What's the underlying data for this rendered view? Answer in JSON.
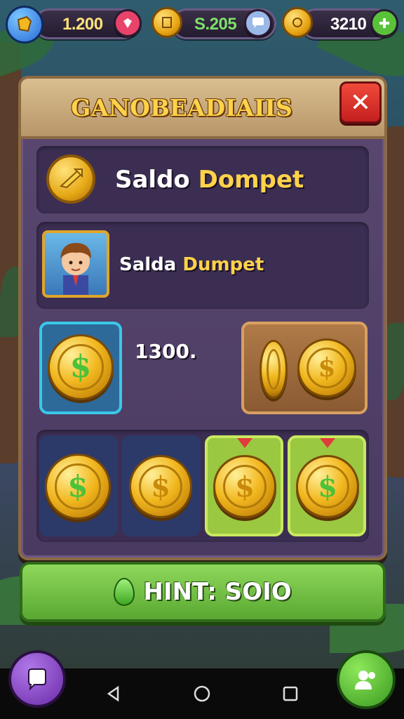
{
  "currencies": [
    {
      "value": "1.200",
      "value_color": "#ffe27a",
      "button": "gem-icon",
      "button_color": "#e8436a"
    },
    {
      "value": "S.205",
      "value_color": "#7fe06a",
      "button": "chat-icon",
      "button_color": "#9ab8e8"
    },
    {
      "value": "3210",
      "value_color": "#ffffff",
      "button": "plus-icon",
      "button_color": "#5ac23a"
    }
  ],
  "panel": {
    "title": "GANOBEADIAIIS",
    "close_label": "✕"
  },
  "wallet": {
    "label_white": "Saldo ",
    "label_gold": "Dompet"
  },
  "profile": {
    "label_white": "Salda ",
    "label_gold": "Dumpet"
  },
  "balance": {
    "amount": "1300."
  },
  "cta": {
    "label": "HINT: SOIO"
  },
  "colors": {
    "accent_gold": "#ffd24a",
    "close_red": "#e0322a",
    "cta_green": "#7ccc4a",
    "panel_purple": "#4a3a62"
  }
}
